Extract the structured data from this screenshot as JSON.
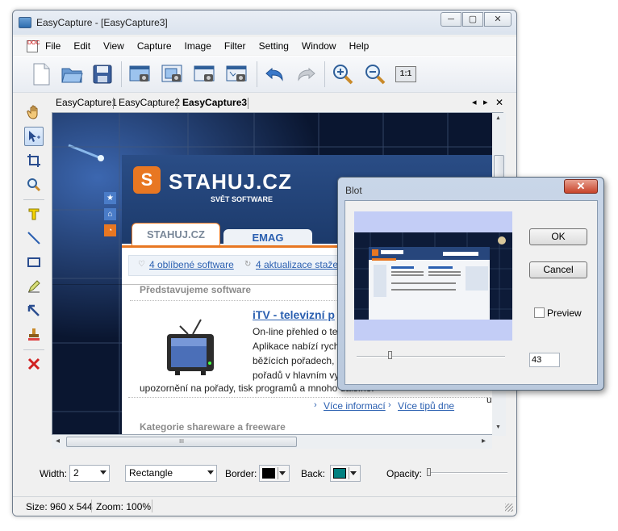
{
  "window": {
    "title": "EasyCapture - [EasyCapture3]",
    "min": "─",
    "max": "▢",
    "close": "✕"
  },
  "menu": [
    "File",
    "Edit",
    "View",
    "Capture",
    "Image",
    "Filter",
    "Setting",
    "Window",
    "Help"
  ],
  "menu_icon_text": "DOC",
  "toolbar": {
    "zoom_1to1_label": "1:1"
  },
  "tabs": [
    "EasyCapture1",
    "EasyCapture2",
    "EasyCapture3"
  ],
  "tab_controls": {
    "prev": "◂",
    "next": "▸",
    "close": "✕"
  },
  "webpage": {
    "logo_title": "STAHUJ.CZ",
    "logo_subtitle": "SVĚT SOFTWARE",
    "tab_active": "STAHUJ.CZ",
    "tab_inactive": "EMAG",
    "link_fav": "4 oblíbené software",
    "link_upd": "4 aktualizace staže",
    "section_intro": "Představujeme software",
    "article_title": "iTV - televizní p",
    "article_l1": "On-line přehled o te",
    "article_l2": "Aplikace nabízí rych",
    "article_l3": "běžících pořadech,",
    "article_l4": "pořadů v hlavním vy",
    "article_l5": "upozornění na pořady, tisk programů a mnoho dalšího.",
    "link_more": "Více informací",
    "link_tips": "Více tipů dne",
    "section_cat": "Kategorie shareware a freeware",
    "side_letter": "u"
  },
  "scroll": {
    "up": "▲",
    "down": "▼",
    "left": "◂",
    "right": "▸",
    "grip": "III"
  },
  "props": {
    "width_label": "Width:",
    "width_value": "2",
    "shape_value": "Rectangle",
    "border_label": "Border:",
    "back_label": "Back:",
    "opacity_label": "Opacity:",
    "opacity_value": 0.0
  },
  "colors": {
    "border": "#000000",
    "back": "#008080",
    "accent": "#e87722"
  },
  "status": {
    "size": "Size: 960 x 544",
    "zoom": "Zoom: 100%"
  },
  "dialog": {
    "title": "Blot",
    "close": "✕",
    "ok": "OK",
    "cancel": "Cancel",
    "preview_label": "Preview",
    "preview_checked": false,
    "slider_value": "43",
    "slider_fraction": 0.23
  },
  "icons": {
    "toolbar": [
      "new-document-icon",
      "open-folder-icon",
      "save-icon",
      "capture-screen-icon",
      "capture-window-icon",
      "capture-region-icon",
      "capture-scroll-icon",
      "undo-icon",
      "redo-icon",
      "zoom-in-icon",
      "zoom-out-icon",
      "actual-size-icon"
    ],
    "tools": [
      "hand-icon",
      "pointer-icon",
      "crop-icon",
      "magnifier-icon",
      "text-icon",
      "line-icon",
      "rectangle-icon",
      "highlighter-icon",
      "arrow-icon",
      "stamp-icon",
      "delete-icon"
    ]
  }
}
